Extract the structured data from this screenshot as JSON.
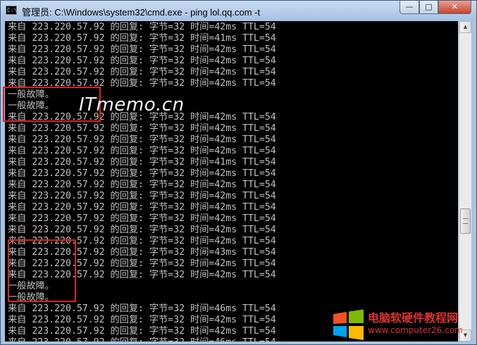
{
  "window": {
    "title": "管理员: C:\\Windows\\system32\\cmd.exe - ping  lol.qq.com -t",
    "minimize_symbol": "—",
    "maximize_symbol": "□",
    "close_symbol": "✕"
  },
  "console": {
    "lines": [
      "来自 223.220.57.92 的回复: 字节=32 时间=42ms TTL=54",
      "来自 223.220.57.92 的回复: 字节=32 时间=41ms TTL=54",
      "来自 223.220.57.92 的回复: 字节=32 时间=42ms TTL=54",
      "来自 223.220.57.92 的回复: 字节=32 时间=42ms TTL=54",
      "来自 223.220.57.92 的回复: 字节=32 时间=42ms TTL=54",
      "来自 223.220.57.92 的回复: 字节=32 时间=42ms TTL=54",
      "一般故障。",
      "一般故障。",
      "来自 223.220.57.92 的回复: 字节=32 时间=42ms TTL=54",
      "来自 223.220.57.92 的回复: 字节=32 时间=42ms TTL=54",
      "来自 223.220.57.92 的回复: 字节=32 时间=42ms TTL=54",
      "来自 223.220.57.92 的回复: 字节=32 时间=42ms TTL=54",
      "来自 223.220.57.92 的回复: 字节=32 时间=41ms TTL=54",
      "来自 223.220.57.92 的回复: 字节=32 时间=42ms TTL=54",
      "来自 223.220.57.92 的回复: 字节=32 时间=42ms TTL=54",
      "来自 223.220.57.92 的回复: 字节=32 时间=42ms TTL=54",
      "来自 223.220.57.92 的回复: 字节=32 时间=42ms TTL=54",
      "来自 223.220.57.92 的回复: 字节=32 时间=42ms TTL=54",
      "来自 223.220.57.92 的回复: 字节=32 时间=42ms TTL=54",
      "来自 223.220.57.92 的回复: 字节=32 时间=42ms TTL=54",
      "来自 223.220.57.92 的回复: 字节=32 时间=43ms TTL=54",
      "来自 223.220.57.92 的回复: 字节=32 时间=42ms TTL=54",
      "来自 223.220.57.92 的回复: 字节=32 时间=42ms TTL=54",
      "一般故障。",
      "一般故障。",
      "来自 223.220.57.92 的回复: 字节=32 时间=46ms TTL=54",
      "来自 223.220.57.92 的回复: 字节=32 时间=42ms TTL=54",
      "来自 223.220.57.92 的回复: 字节=32 时间=42ms TTL=54",
      "来自 223.220.57.92 的回复: 字节=32 时间=46ms TTL=54"
    ]
  },
  "scrollbar": {
    "up_symbol": "▲",
    "down_symbol": "▼"
  },
  "watermark": {
    "text": "ITmemo.cn"
  },
  "brand": {
    "name": "电脑软硬件教程网",
    "url": "www.computer26.com",
    "logo_colors": [
      "#f25022",
      "#7fba00",
      "#00a4ef",
      "#ffb900"
    ]
  },
  "highlight_color": "#e02020"
}
